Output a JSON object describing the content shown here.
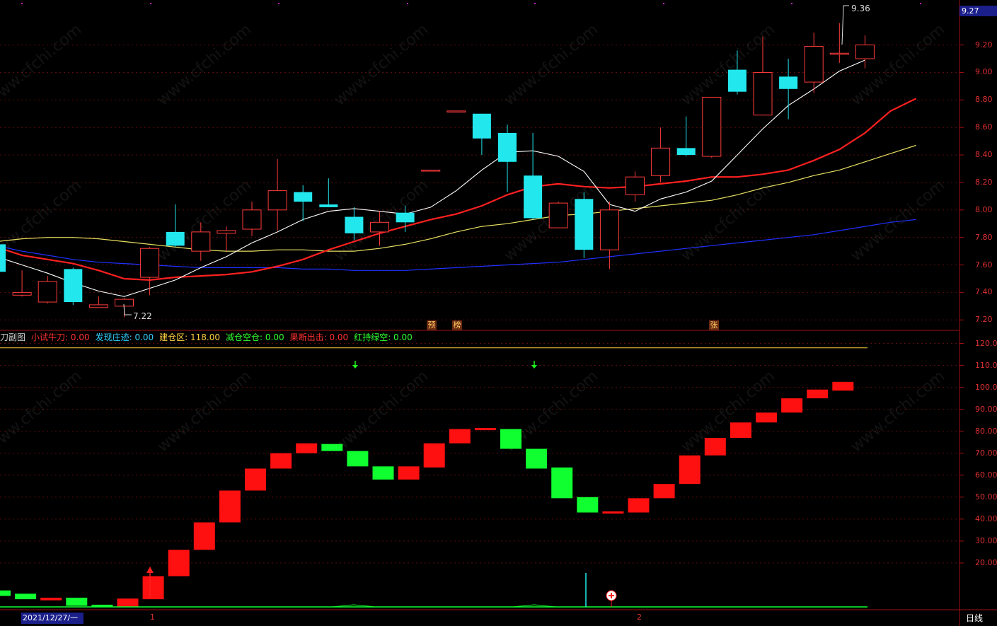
{
  "price_tag": "9.27",
  "high_label": "9.36",
  "low_label": "7.22",
  "period_label": "日线",
  "date_label": "2021/12/27/一",
  "month_labels": [
    "1",
    "2"
  ],
  "badges": [
    "预",
    "榜",
    "张"
  ],
  "watermark": "www.cfchi.com",
  "indicator_header": [
    {
      "text": "刀副图",
      "color": "#d0d0d0"
    },
    {
      "text": "小试牛刀: 0.00",
      "color": "#ff3030"
    },
    {
      "text": "发现庄迹: 0.00",
      "color": "#30d0ff"
    },
    {
      "text": "建仓区: 118.00",
      "color": "#ffd040"
    },
    {
      "text": "减仓空仓: 0.00",
      "color": "#30ff30"
    },
    {
      "text": "果断出击: 0.00",
      "color": "#ff3030"
    },
    {
      "text": "红持绿空: 0.00",
      "color": "#30ff30"
    }
  ],
  "colors": {
    "up": "#ff3b3b",
    "down": "#22e8ee",
    "ma5": "#ffffff",
    "ma10": "#ff2020",
    "ma20": "#e8e060",
    "ma60": "#2030ff",
    "bar_up": "#ff1010",
    "bar_down": "#10ff30"
  },
  "chart_data": [
    {
      "type": "candlestick",
      "title": "",
      "ylim": [
        7.15,
        9.45
      ],
      "yticks": [
        "9.20",
        "9.00",
        "8.80",
        "8.60",
        "8.40",
        "8.20",
        "8.00",
        "7.80",
        "7.60",
        "7.40",
        "7.20"
      ],
      "candles": [
        {
          "o": 7.75,
          "c": 7.55,
          "h": 7.76,
          "l": 7.53
        },
        {
          "o": 7.38,
          "c": 7.4,
          "h": 7.56,
          "l": 7.37
        },
        {
          "o": 7.33,
          "c": 7.48,
          "h": 7.52,
          "l": 7.32
        },
        {
          "o": 7.57,
          "c": 7.33,
          "h": 7.58,
          "l": 7.31
        },
        {
          "o": 7.29,
          "c": 7.31,
          "h": 7.37,
          "l": 7.29
        },
        {
          "o": 7.3,
          "c": 7.35,
          "h": 7.36,
          "l": 7.22
        },
        {
          "o": 7.51,
          "c": 7.72,
          "h": 7.73,
          "l": 7.38
        },
        {
          "o": 7.84,
          "c": 7.74,
          "h": 8.04,
          "l": 7.73
        },
        {
          "o": 7.7,
          "c": 7.84,
          "h": 7.91,
          "l": 7.63
        },
        {
          "o": 7.83,
          "c": 7.85,
          "h": 7.88,
          "l": 7.7
        },
        {
          "o": 7.86,
          "c": 8.0,
          "h": 8.06,
          "l": 7.81
        },
        {
          "o": 8.0,
          "c": 8.14,
          "h": 8.37,
          "l": 7.85
        },
        {
          "o": 8.13,
          "c": 8.06,
          "h": 8.18,
          "l": 7.92
        },
        {
          "o": 8.04,
          "c": 8.02,
          "h": 8.23,
          "l": 8.02
        },
        {
          "o": 7.95,
          "c": 7.83,
          "h": 8.02,
          "l": 7.78
        },
        {
          "o": 7.84,
          "c": 7.91,
          "h": 7.99,
          "l": 7.74
        },
        {
          "o": 7.98,
          "c": 7.91,
          "h": 8.03,
          "l": 7.84
        },
        {
          "o": 8.29,
          "c": 8.29,
          "h": 8.29,
          "l": 8.29
        },
        {
          "o": 8.72,
          "c": 8.72,
          "h": 8.72,
          "l": 8.72
        },
        {
          "o": 8.7,
          "c": 8.52,
          "h": 8.7,
          "l": 8.4
        },
        {
          "o": 8.56,
          "c": 8.35,
          "h": 8.62,
          "l": 8.13
        },
        {
          "o": 8.25,
          "c": 7.94,
          "h": 8.56,
          "l": 7.93
        },
        {
          "o": 7.87,
          "c": 8.05,
          "h": 8.06,
          "l": 7.87
        },
        {
          "o": 8.08,
          "c": 7.71,
          "h": 8.13,
          "l": 7.65
        },
        {
          "o": 7.71,
          "c": 8.0,
          "h": 8.06,
          "l": 7.57
        },
        {
          "o": 8.11,
          "c": 8.24,
          "h": 8.28,
          "l": 8.06
        },
        {
          "o": 8.25,
          "c": 8.45,
          "h": 8.6,
          "l": 8.2
        },
        {
          "o": 8.45,
          "c": 8.4,
          "h": 8.68,
          "l": 8.39
        },
        {
          "o": 8.39,
          "c": 8.82,
          "h": 8.82,
          "l": 8.38
        },
        {
          "o": 9.02,
          "c": 8.86,
          "h": 9.16,
          "l": 8.84
        },
        {
          "o": 8.69,
          "c": 9.0,
          "h": 9.26,
          "l": 8.69
        },
        {
          "o": 8.97,
          "c": 8.88,
          "h": 9.1,
          "l": 8.66
        },
        {
          "o": 8.93,
          "c": 9.19,
          "h": 9.29,
          "l": 8.85
        },
        {
          "o": 9.14,
          "c": 9.14,
          "h": 9.36,
          "l": 9.07
        },
        {
          "o": 9.1,
          "c": 9.2,
          "h": 9.27,
          "l": 9.03
        }
      ],
      "ma5": [
        7.66,
        7.6,
        7.54,
        7.47,
        7.41,
        7.37,
        7.43,
        7.49,
        7.58,
        7.66,
        7.76,
        7.84,
        7.93,
        7.99,
        8.01,
        7.99,
        7.97,
        8.02,
        8.14,
        8.29,
        8.42,
        8.43,
        8.39,
        8.28,
        8.04,
        7.99,
        8.08,
        8.13,
        8.21,
        8.4,
        8.59,
        8.76,
        8.88,
        9.01,
        9.09
      ],
      "ma10": [
        7.73,
        7.67,
        7.64,
        7.61,
        7.56,
        7.5,
        7.49,
        7.51,
        7.52,
        7.53,
        7.55,
        7.59,
        7.64,
        7.71,
        7.77,
        7.83,
        7.88,
        7.93,
        7.97,
        8.03,
        8.11,
        8.17,
        8.19,
        8.17,
        8.16,
        8.17,
        8.19,
        8.21,
        8.24,
        8.24,
        8.26,
        8.29,
        8.36,
        8.44,
        8.56,
        8.72,
        8.81
      ],
      "ma20": [
        7.77,
        7.79,
        7.8,
        7.8,
        7.79,
        7.77,
        7.75,
        7.73,
        7.71,
        7.7,
        7.7,
        7.71,
        7.71,
        7.7,
        7.7,
        7.72,
        7.75,
        7.79,
        7.84,
        7.88,
        7.9,
        7.93,
        7.96,
        7.97,
        7.99,
        8.01,
        8.03,
        8.05,
        8.07,
        8.11,
        8.16,
        8.2,
        8.25,
        8.29,
        8.35,
        8.41,
        8.47
      ],
      "ma60": [
        7.74,
        7.7,
        7.67,
        7.64,
        7.62,
        7.61,
        7.6,
        7.59,
        7.58,
        7.58,
        7.58,
        7.58,
        7.57,
        7.57,
        7.56,
        7.56,
        7.56,
        7.57,
        7.58,
        7.59,
        7.6,
        7.61,
        7.62,
        7.64,
        7.66,
        7.68,
        7.7,
        7.72,
        7.74,
        7.76,
        7.78,
        7.8,
        7.82,
        7.85,
        7.88,
        7.91,
        7.93
      ]
    },
    {
      "type": "bar",
      "title": "刀副图",
      "ylim": [
        0,
        125
      ],
      "yticks": [
        "120.00",
        "110.00",
        "100.00",
        "90.00",
        "80.00",
        "70.00",
        "60.00",
        "50.00",
        "40.00",
        "30.00",
        "20.00"
      ],
      "reference_line": 118,
      "blocks": [
        {
          "lo": 5,
          "hi": 7.5,
          "up": false
        },
        {
          "lo": 3.5,
          "hi": 6,
          "up": false
        },
        {
          "lo": 3,
          "hi": 4.2,
          "up": true
        },
        {
          "lo": 0.5,
          "hi": 4.2,
          "up": false
        },
        {
          "lo": 0,
          "hi": 1,
          "up": false
        },
        {
          "lo": 0,
          "hi": 3.8,
          "up": true
        },
        {
          "lo": 3.5,
          "hi": 14,
          "up": true
        },
        {
          "lo": 14,
          "hi": 26,
          "up": true
        },
        {
          "lo": 26,
          "hi": 38.5,
          "up": true
        },
        {
          "lo": 38.5,
          "hi": 53,
          "up": true
        },
        {
          "lo": 53,
          "hi": 63,
          "up": true
        },
        {
          "lo": 63,
          "hi": 70,
          "up": true
        },
        {
          "lo": 70,
          "hi": 74.5,
          "up": true
        },
        {
          "lo": 71,
          "hi": 74.2,
          "up": false
        },
        {
          "lo": 64,
          "hi": 71,
          "up": false
        },
        {
          "lo": 58,
          "hi": 64,
          "up": false
        },
        {
          "lo": 58,
          "hi": 64,
          "up": true
        },
        {
          "lo": 63.5,
          "hi": 74.5,
          "up": true
        },
        {
          "lo": 74.5,
          "hi": 81,
          "up": true
        },
        {
          "lo": 80.5,
          "hi": 81.5,
          "up": true
        },
        {
          "lo": 72,
          "hi": 81,
          "up": false
        },
        {
          "lo": 63,
          "hi": 72,
          "up": false
        },
        {
          "lo": 49.5,
          "hi": 63.5,
          "up": false
        },
        {
          "lo": 43,
          "hi": 50,
          "up": false
        },
        {
          "lo": 42.5,
          "hi": 43.5,
          "up": true
        },
        {
          "lo": 43,
          "hi": 49.5,
          "up": true
        },
        {
          "lo": 49.5,
          "hi": 56,
          "up": true
        },
        {
          "lo": 56,
          "hi": 69,
          "up": true
        },
        {
          "lo": 69,
          "hi": 77,
          "up": true
        },
        {
          "lo": 77,
          "hi": 84,
          "up": true
        },
        {
          "lo": 84,
          "hi": 88.5,
          "up": true
        },
        {
          "lo": 88.5,
          "hi": 95,
          "up": true
        },
        {
          "lo": 95,
          "hi": 99,
          "up": true
        },
        {
          "lo": 98.5,
          "hi": 102.5,
          "up": true
        }
      ]
    }
  ]
}
